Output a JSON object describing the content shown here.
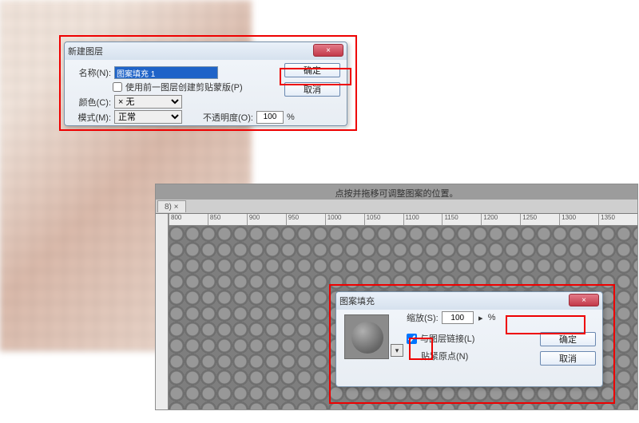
{
  "dialog1": {
    "title": "新建图层",
    "name_label": "名称(N):",
    "name_value": "图案填充 1",
    "clip_checkbox_label": "使用前一图层创建剪贴蒙版(P)",
    "color_label": "颜色(C):",
    "color_value": "× 无",
    "mode_label": "模式(M):",
    "mode_value": "正常",
    "opacity_label": "不透明度(O):",
    "opacity_value": "100",
    "opacity_unit": "%",
    "ok": "确定",
    "cancel": "取消",
    "close_x": "×"
  },
  "workspace": {
    "hint": "点按并拖移可调整图案的位置。",
    "tab": "8) ×",
    "ruler": [
      "800",
      "850",
      "900",
      "950",
      "1000",
      "1050",
      "1100",
      "1150",
      "1200",
      "1250",
      "1300",
      "1350"
    ]
  },
  "dialog2": {
    "title": "图案填充",
    "scale_label": "缩放(S):",
    "scale_value": "100",
    "scale_unit": "%",
    "link_label": "与图层链接(L)",
    "snap_label": "贴紧原点(N)",
    "ok": "确定",
    "cancel": "取消",
    "close_x": "×",
    "swatch_dd": "▾"
  }
}
